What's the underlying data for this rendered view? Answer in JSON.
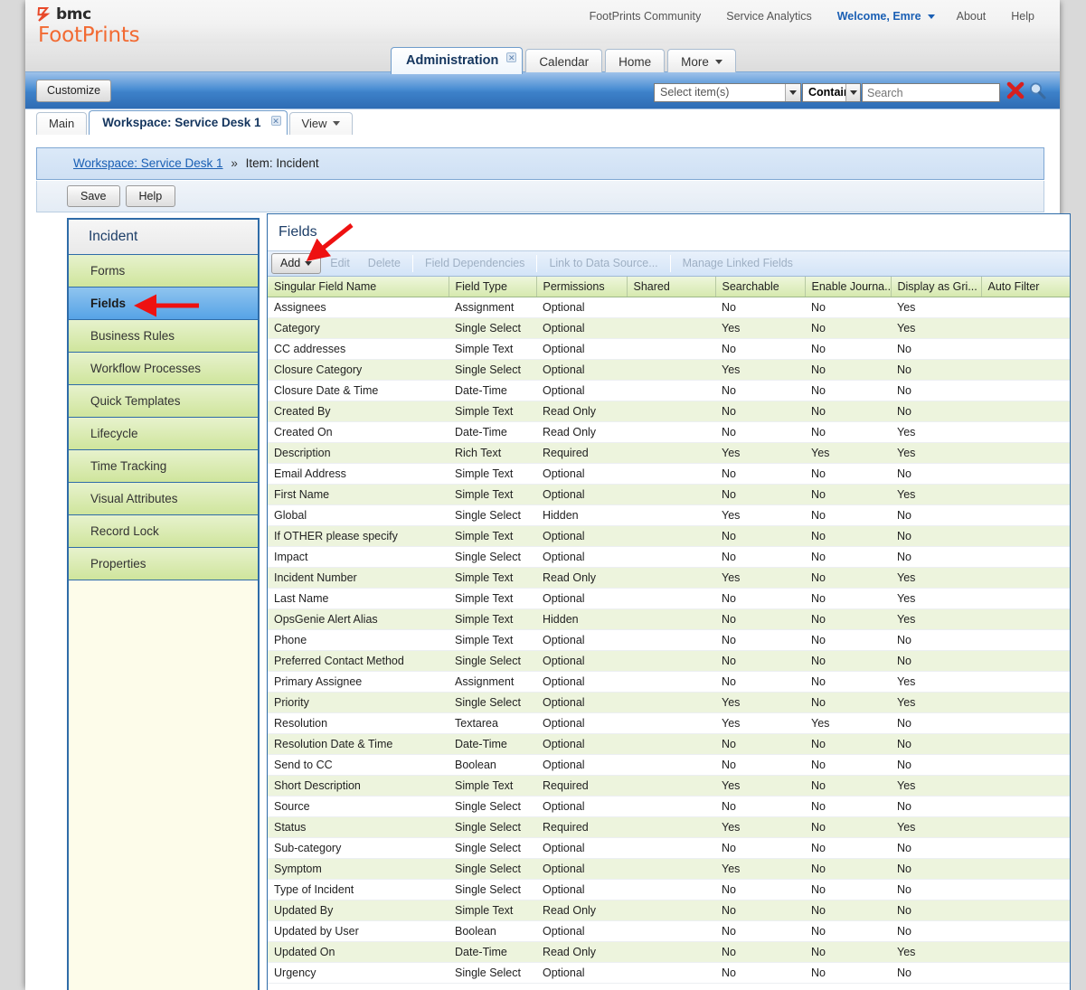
{
  "brand": {
    "mark": "bmc-logo",
    "name_bold": "bmc",
    "product": "FootPrints",
    "accent": "#f26a32"
  },
  "topnav": {
    "links": [
      {
        "label": "FootPrints Community",
        "active": false
      },
      {
        "label": "Service Analytics",
        "active": false
      },
      {
        "label": "Welcome, Emre",
        "active": true
      },
      {
        "label": "About",
        "active": false
      },
      {
        "label": "Help",
        "active": false
      }
    ]
  },
  "main_tabs": [
    {
      "label": "Administration",
      "active": true,
      "closable": true
    },
    {
      "label": "Calendar",
      "active": false,
      "closable": false
    },
    {
      "label": "Home",
      "active": false,
      "closable": false
    },
    {
      "label": "More",
      "active": false,
      "closable": false,
      "dropdown": true
    }
  ],
  "toolbar": {
    "customize_label": "Customize",
    "select_items_value": "Select item(s)",
    "operator_value": "Contains",
    "search_placeholder": "Search",
    "clear_icon": "red-x-icon",
    "search_icon": "magnifier-icon"
  },
  "sub_tabs": [
    {
      "label": "Main",
      "active": false,
      "closable": false
    },
    {
      "label": "Workspace: Service Desk 1",
      "active": true,
      "closable": true
    },
    {
      "label": "View",
      "active": false,
      "closable": false,
      "dropdown": true
    }
  ],
  "breadcrumb": {
    "link": "Workspace: Service Desk 1",
    "separator": "»",
    "current": "Item: Incident"
  },
  "action_buttons": {
    "save": "Save",
    "help": "Help"
  },
  "sidebar": {
    "title": "Incident",
    "items": [
      {
        "label": "Forms",
        "active": false
      },
      {
        "label": "Fields",
        "active": true
      },
      {
        "label": "Business Rules",
        "active": false
      },
      {
        "label": "Workflow Processes",
        "active": false
      },
      {
        "label": "Quick Templates",
        "active": false
      },
      {
        "label": "Lifecycle",
        "active": false
      },
      {
        "label": "Time Tracking",
        "active": false
      },
      {
        "label": "Visual Attributes",
        "active": false
      },
      {
        "label": "Record Lock",
        "active": false
      },
      {
        "label": "Properties",
        "active": false
      }
    ]
  },
  "panel": {
    "title": "Fields",
    "buttons": [
      {
        "label": "Add",
        "enabled": true,
        "dropdown": true
      },
      {
        "label": "Edit",
        "enabled": false
      },
      {
        "label": "Delete",
        "enabled": false
      },
      {
        "label": "Field Dependencies",
        "enabled": false
      },
      {
        "label": "Link to Data Source...",
        "enabled": false
      },
      {
        "label": "Manage Linked Fields",
        "enabled": false
      }
    ]
  },
  "grid": {
    "columns": [
      "Singular Field Name",
      "Field Type",
      "Permissions",
      "Shared",
      "Searchable",
      "Enable Journa...",
      "Display as Gri...",
      "Auto Filter"
    ],
    "rows": [
      [
        "Assignees",
        "Assignment",
        "Optional",
        "",
        "No",
        "No",
        "Yes",
        ""
      ],
      [
        "Category",
        "Single Select",
        "Optional",
        "",
        "Yes",
        "No",
        "Yes",
        ""
      ],
      [
        "CC addresses",
        "Simple Text",
        "Optional",
        "",
        "No",
        "No",
        "No",
        ""
      ],
      [
        "Closure Category",
        "Single Select",
        "Optional",
        "",
        "Yes",
        "No",
        "No",
        ""
      ],
      [
        "Closure Date & Time",
        "Date-Time",
        "Optional",
        "",
        "No",
        "No",
        "No",
        ""
      ],
      [
        "Created By",
        "Simple Text",
        "Read Only",
        "",
        "No",
        "No",
        "No",
        ""
      ],
      [
        "Created On",
        "Date-Time",
        "Read Only",
        "",
        "No",
        "No",
        "Yes",
        ""
      ],
      [
        "Description",
        "Rich Text",
        "Required",
        "",
        "Yes",
        "Yes",
        "Yes",
        ""
      ],
      [
        "Email Address",
        "Simple Text",
        "Optional",
        "",
        "No",
        "No",
        "No",
        ""
      ],
      [
        "First Name",
        "Simple Text",
        "Optional",
        "",
        "No",
        "No",
        "Yes",
        ""
      ],
      [
        "Global",
        "Single Select",
        "Hidden",
        "",
        "Yes",
        "No",
        "No",
        ""
      ],
      [
        "If OTHER please specify",
        "Simple Text",
        "Optional",
        "",
        "No",
        "No",
        "No",
        ""
      ],
      [
        "Impact",
        "Single Select",
        "Optional",
        "",
        "No",
        "No",
        "No",
        ""
      ],
      [
        "Incident Number",
        "Simple Text",
        "Read Only",
        "",
        "Yes",
        "No",
        "Yes",
        ""
      ],
      [
        "Last Name",
        "Simple Text",
        "Optional",
        "",
        "No",
        "No",
        "Yes",
        ""
      ],
      [
        "OpsGenie Alert Alias",
        "Simple Text",
        "Hidden",
        "",
        "No",
        "No",
        "Yes",
        ""
      ],
      [
        "Phone",
        "Simple Text",
        "Optional",
        "",
        "No",
        "No",
        "No",
        ""
      ],
      [
        "Preferred Contact Method",
        "Single Select",
        "Optional",
        "",
        "No",
        "No",
        "No",
        ""
      ],
      [
        "Primary Assignee",
        "Assignment",
        "Optional",
        "",
        "No",
        "No",
        "Yes",
        ""
      ],
      [
        "Priority",
        "Single Select",
        "Optional",
        "",
        "Yes",
        "No",
        "Yes",
        ""
      ],
      [
        "Resolution",
        "Textarea",
        "Optional",
        "",
        "Yes",
        "Yes",
        "No",
        ""
      ],
      [
        "Resolution Date & Time",
        "Date-Time",
        "Optional",
        "",
        "No",
        "No",
        "No",
        ""
      ],
      [
        "Send to CC",
        "Boolean",
        "Optional",
        "",
        "No",
        "No",
        "No",
        ""
      ],
      [
        "Short Description",
        "Simple Text",
        "Required",
        "",
        "Yes",
        "No",
        "Yes",
        ""
      ],
      [
        "Source",
        "Single Select",
        "Optional",
        "",
        "No",
        "No",
        "No",
        ""
      ],
      [
        "Status",
        "Single Select",
        "Required",
        "",
        "Yes",
        "No",
        "Yes",
        ""
      ],
      [
        "Sub-category",
        "Single Select",
        "Optional",
        "",
        "No",
        "No",
        "No",
        ""
      ],
      [
        "Symptom",
        "Single Select",
        "Optional",
        "",
        "Yes",
        "No",
        "No",
        ""
      ],
      [
        "Type of Incident",
        "Single Select",
        "Optional",
        "",
        "No",
        "No",
        "No",
        ""
      ],
      [
        "Updated By",
        "Simple Text",
        "Read Only",
        "",
        "No",
        "No",
        "No",
        ""
      ],
      [
        "Updated by User",
        "Boolean",
        "Optional",
        "",
        "No",
        "No",
        "No",
        ""
      ],
      [
        "Updated On",
        "Date-Time",
        "Read Only",
        "",
        "No",
        "No",
        "Yes",
        ""
      ],
      [
        "Urgency",
        "Single Select",
        "Optional",
        "",
        "No",
        "No",
        "No",
        ""
      ]
    ]
  },
  "annotations": [
    {
      "name": "arrow-to-add-button",
      "color": "#ee1111",
      "direction": "down-left"
    },
    {
      "name": "arrow-to-fields-menu",
      "color": "#ee1111",
      "direction": "left"
    }
  ]
}
